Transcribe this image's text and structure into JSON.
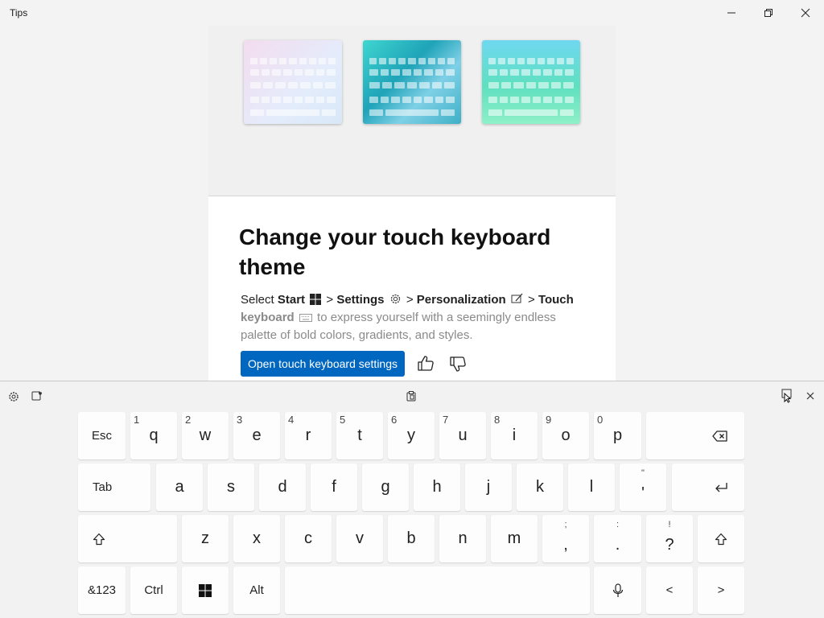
{
  "window": {
    "title": "Tips"
  },
  "tip": {
    "heading": "Change your touch keyboard theme",
    "body_line": [
      "Select ",
      "Start",
      " > ",
      "Settings",
      " > ",
      "Personalization",
      " > ",
      "Touch",
      "keyboard",
      " to express yourself with a seemingly endless palette of bold colors, gradients, and styles."
    ],
    "button": "Open touch keyboard settings"
  },
  "keyboard": {
    "row1": [
      {
        "main": "Esc"
      },
      {
        "main": "q",
        "sub": "1"
      },
      {
        "main": "w",
        "sub": "2"
      },
      {
        "main": "e",
        "sub": "3"
      },
      {
        "main": "r",
        "sub": "4"
      },
      {
        "main": "t",
        "sub": "5"
      },
      {
        "main": "y",
        "sub": "6"
      },
      {
        "main": "u",
        "sub": "7"
      },
      {
        "main": "i",
        "sub": "8"
      },
      {
        "main": "o",
        "sub": "9"
      },
      {
        "main": "p",
        "sub": "0"
      }
    ],
    "row2": [
      {
        "main": "Tab"
      },
      {
        "main": "a"
      },
      {
        "main": "s"
      },
      {
        "main": "d"
      },
      {
        "main": "f"
      },
      {
        "main": "g"
      },
      {
        "main": "h"
      },
      {
        "main": "j"
      },
      {
        "main": "k"
      },
      {
        "main": "l"
      },
      {
        "main": "'",
        "top": "\""
      }
    ],
    "row3": [
      {
        "main": "z"
      },
      {
        "main": "x"
      },
      {
        "main": "c"
      },
      {
        "main": "v"
      },
      {
        "main": "b"
      },
      {
        "main": "n"
      },
      {
        "main": "m"
      },
      {
        "main": ",",
        "top": ";"
      },
      {
        "main": ".",
        "top": ":"
      },
      {
        "main": "?",
        "top": "!"
      }
    ],
    "row4": [
      {
        "main": "&123"
      },
      {
        "main": "Ctrl"
      },
      {
        "main": "Alt"
      },
      {
        "main": "<"
      },
      {
        "main": ">"
      }
    ]
  }
}
